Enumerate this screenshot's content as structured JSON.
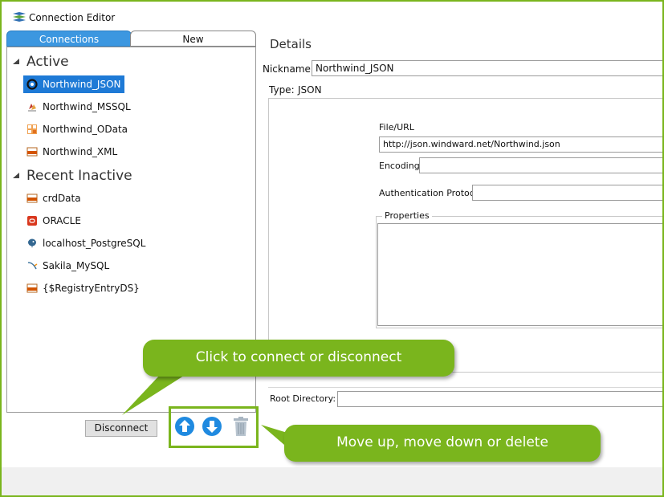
{
  "window": {
    "title": "Connection Editor"
  },
  "tabs": {
    "connections": "Connections",
    "new": "New"
  },
  "tree": {
    "active": {
      "label": "Active",
      "items": [
        {
          "label": "Northwind_JSON",
          "icon": "json-datasource-icon",
          "selected": true
        },
        {
          "label": "Northwind_MSSQL",
          "icon": "mssql-datasource-icon"
        },
        {
          "label": "Northwind_OData",
          "icon": "odata-datasource-icon"
        },
        {
          "label": "Northwind_XML",
          "icon": "xml-datasource-icon"
        }
      ]
    },
    "recent": {
      "label": "Recent Inactive",
      "items": [
        {
          "label": "crdData",
          "icon": "xml-datasource-icon"
        },
        {
          "label": "ORACLE",
          "icon": "oracle-datasource-icon"
        },
        {
          "label": "localhost_PostgreSQL",
          "icon": "postgresql-datasource-icon"
        },
        {
          "label": "Sakila_MySQL",
          "icon": "mysql-datasource-icon"
        },
        {
          "label": "{$RegistryEntryDS}",
          "icon": "xml-datasource-icon"
        }
      ]
    }
  },
  "buttons": {
    "disconnect": "Disconnect",
    "move_up_icon": "arrow-up-circle-icon",
    "move_down_icon": "arrow-down-circle-icon",
    "delete_icon": "trash-icon"
  },
  "details": {
    "title": "Details",
    "nickname_label": "Nickname:",
    "nickname_value": "Northwind_JSON",
    "type_label": "Type:",
    "type_value": "JSON",
    "file_url_label": "File/URL",
    "file_url_value": "http://json.windward.net/Northwind.json",
    "encoding_label": "Encoding:",
    "encoding_value": "",
    "auth_label": "Authentication Protocol",
    "auth_value": "",
    "properties_label": "Properties",
    "root_dir_label": "Root Directory:",
    "root_dir_value": ""
  },
  "callouts": {
    "connect": "Click to connect or disconnect",
    "reorder": "Move up, move down or delete"
  },
  "colors": {
    "accent_green": "#7ab51d",
    "tab_blue": "#3c97e0",
    "selection_blue": "#1e7ad6",
    "button_blue": "#1f8ae0"
  }
}
